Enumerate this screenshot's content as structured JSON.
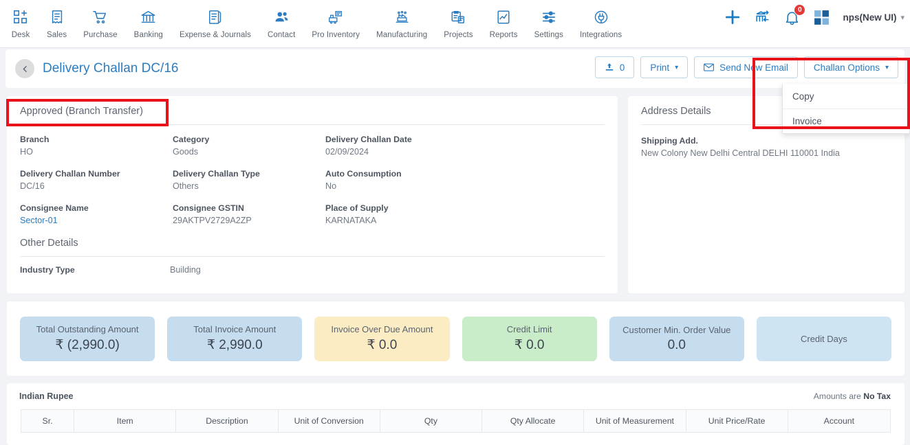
{
  "topnav": {
    "items": [
      {
        "label": "Desk",
        "icon": "desk-grid-plus-icon"
      },
      {
        "label": "Sales",
        "icon": "sales-receipt-icon"
      },
      {
        "label": "Purchase",
        "icon": "purchase-cart-icon"
      },
      {
        "label": "Banking",
        "icon": "banking-bank-icon"
      },
      {
        "label": "Expense & Journals",
        "icon": "expense-journal-icon"
      },
      {
        "label": "Contact",
        "icon": "contact-people-icon"
      },
      {
        "label": "Pro Inventory",
        "icon": "pro-inventory-icon"
      },
      {
        "label": "Manufacturing",
        "icon": "manufacturing-icon"
      },
      {
        "label": "Projects",
        "icon": "projects-clipboard-icon"
      },
      {
        "label": "Reports",
        "icon": "reports-chart-icon"
      },
      {
        "label": "Settings",
        "icon": "settings-sliders-icon"
      },
      {
        "label": "Integrations",
        "icon": "integrations-plug-icon"
      }
    ],
    "right": {
      "add_icon": "plus-icon",
      "bank_icon": "bank-transfer-icon",
      "bell_icon": "notification-bell-icon",
      "notification_count": "0",
      "apps_icon": "apps-grid-icon",
      "user_label": "nps(New UI)",
      "user_caret": "chevron-down-icon"
    }
  },
  "header": {
    "back_icon": "chevron-left-icon",
    "title": "Delivery Challan DC/16",
    "buttons": {
      "attachment_icon": "upload-attachment-icon",
      "attachment_count": "0",
      "print_label": "Print",
      "print_caret": "chevron-down-icon",
      "email_icon": "envelope-icon",
      "email_label": "Send New Email",
      "options_label": "Challan Options",
      "options_caret": "chevron-down-icon"
    }
  },
  "dropdown": {
    "items": [
      {
        "label": "Copy"
      },
      {
        "label": "Invoice"
      }
    ]
  },
  "details": {
    "status": "Approved (Branch Transfer)",
    "fields": [
      {
        "key": "Branch",
        "value": "HO",
        "link": false
      },
      {
        "key": "Category",
        "value": "Goods",
        "link": false
      },
      {
        "key": "Delivery Challan Date",
        "value": "02/09/2024",
        "link": false
      },
      {
        "key": "Delivery Challan Number",
        "value": "DC/16",
        "link": false
      },
      {
        "key": "Delivery Challan Type",
        "value": "Others",
        "link": false
      },
      {
        "key": "Auto Consumption",
        "value": "No",
        "link": false
      },
      {
        "key": "Consignee Name",
        "value": "Sector-01",
        "link": true
      },
      {
        "key": "Consignee GSTIN",
        "value": "29AKTPV2729A2ZP",
        "link": false
      },
      {
        "key": "Place of Supply",
        "value": "KARNATAKA",
        "link": false
      }
    ],
    "other_details_title": "Other Details",
    "industry_key": "Industry Type",
    "industry_value": "Building"
  },
  "address": {
    "title": "Address Details",
    "shipping_key": "Shipping Add.",
    "shipping_value": "New Colony New Delhi Central DELHI 110001 India"
  },
  "kpis": [
    {
      "label": "Total Outstanding Amount",
      "value": "₹ (2,990.0)",
      "bg": "#c5ddef"
    },
    {
      "label": "Total Invoice Amount",
      "value": "₹ 2,990.0",
      "bg": "#c5ddef"
    },
    {
      "label": "Invoice Over Due Amount",
      "value": "₹ 0.0",
      "bg": "#fcecc4"
    },
    {
      "label": "Credit Limit",
      "value": "₹ 0.0",
      "bg": "#c9ecc9"
    },
    {
      "label": "Customer Min. Order Value",
      "value": "0.0",
      "bg": "#c5ddef"
    },
    {
      "label": "Credit Days",
      "value": "",
      "bg": "#cfe4f2"
    }
  ],
  "items": {
    "currency": "Indian Rupee",
    "tax_prefix": "Amounts are ",
    "tax_value": "No Tax",
    "columns": [
      {
        "label": "Sr.",
        "w": 78
      },
      {
        "label": "Item",
        "w": 150
      },
      {
        "label": "Description",
        "w": 150
      },
      {
        "label": "Unit of Conversion",
        "w": 150
      },
      {
        "label": "Qty",
        "w": 150
      },
      {
        "label": "Qty Allocate",
        "w": 150
      },
      {
        "label": "Unit of Measurement",
        "w": 150
      },
      {
        "label": "Unit Price/Rate",
        "w": 150
      },
      {
        "label": "Account",
        "w": 150
      }
    ]
  },
  "colors": {
    "brand_blue": "#2b7cc0",
    "annotation_red": "#e8131a",
    "page_bg": "#f1f3f6"
  }
}
